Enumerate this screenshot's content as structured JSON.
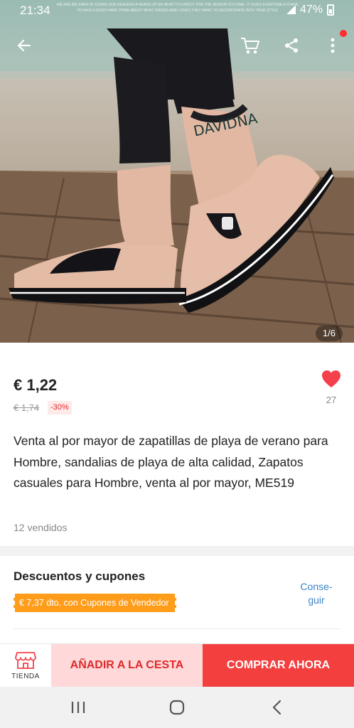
{
  "status": {
    "time": "21:34",
    "battery": "47%",
    "banner_lines": [
      "WE ARE BIG FANS OF GIVING OUR READERS A HEADS UP ON WHAT TO EXPECT FOR THE SEASON TO COME. IT GIVES EVERYONE A CHANCE",
      "TO HAVE A GOOD HARD THINK ABOUT WHAT TRENDS AND LOOKS THEY WANT TO INCORPORATE INTO THEIR STYLE."
    ]
  },
  "gallery": {
    "counter": "1/6"
  },
  "product": {
    "price": "€ 1,22",
    "old_price": "€ 1,74",
    "discount": "-30%",
    "favorites_count": "27",
    "title": "Venta al por mayor de zapatillas de playa de verano para Hombre, sandalias de playa de alta calidad, Zapatos casuales para Hombre, venta al por mayor, ME519",
    "sold": "12 vendidos"
  },
  "coupons": {
    "title": "Descuentos y cupones",
    "tag": "€ 7,37 dto. con Cupones de Vendedor",
    "get_label_line1": "Conse-",
    "get_label_line2": "guir"
  },
  "actions": {
    "store_label": "TIENDA",
    "add_to_cart": "AÑADIR A LA CESTA",
    "buy_now": "COMPRAR AHORA"
  },
  "colors": {
    "accent_red": "#f43f3f",
    "add_bg": "#ffd9d9",
    "coupon_orange": "#ff9c1a",
    "link_blue": "#3a83c6"
  },
  "icons": {
    "back": "arrow-left-icon",
    "cart": "cart-icon",
    "share": "share-icon",
    "more": "more-vertical-icon",
    "favorite": "heart-icon",
    "store": "store-icon",
    "nav_recents": "recents-icon",
    "nav_home": "home-icon",
    "nav_back": "nav-back-icon"
  }
}
